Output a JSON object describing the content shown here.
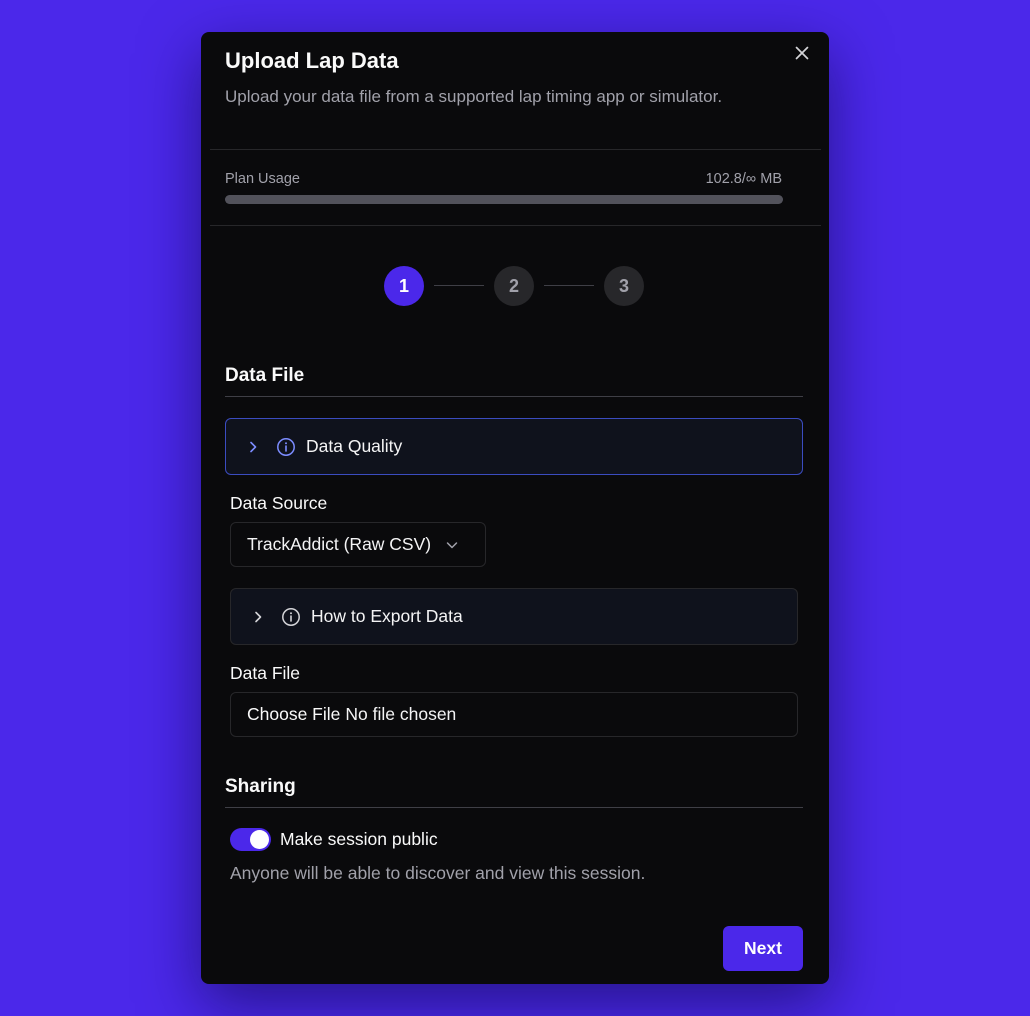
{
  "dialog": {
    "title": "Upload Lap Data",
    "subtitle": "Upload your data file from a supported lap timing app or simulator.",
    "close_icon": "close-icon"
  },
  "plan_usage": {
    "label": "Plan Usage",
    "value": "102.8/∞ MB",
    "progress_fraction": 0
  },
  "stepper": {
    "steps": [
      "1",
      "2",
      "3"
    ],
    "active_index": 0,
    "active_color": "#4b28ea"
  },
  "data_file_section": {
    "title": "Data File",
    "data_quality": {
      "label": "Data Quality",
      "icon": "info-icon"
    },
    "data_source": {
      "label": "Data Source",
      "selected": "TrackAddict (Raw CSV)"
    },
    "how_to_export": {
      "label": "How to Export Data",
      "icon": "info-icon"
    },
    "file_field": {
      "label": "Data File",
      "button_label": "Choose File",
      "status": "No file chosen"
    }
  },
  "sharing_section": {
    "title": "Sharing",
    "toggle": {
      "label": "Make session public",
      "on": true,
      "help": "Anyone will be able to discover and view this session."
    }
  },
  "footer": {
    "next_label": "Next"
  },
  "colors": {
    "background": "#4b28ea",
    "modal": "#0a0a0c",
    "accent": "#4b28ea",
    "muted_text": "#a1a1aa",
    "highlight_border": "#3b4cc0"
  }
}
